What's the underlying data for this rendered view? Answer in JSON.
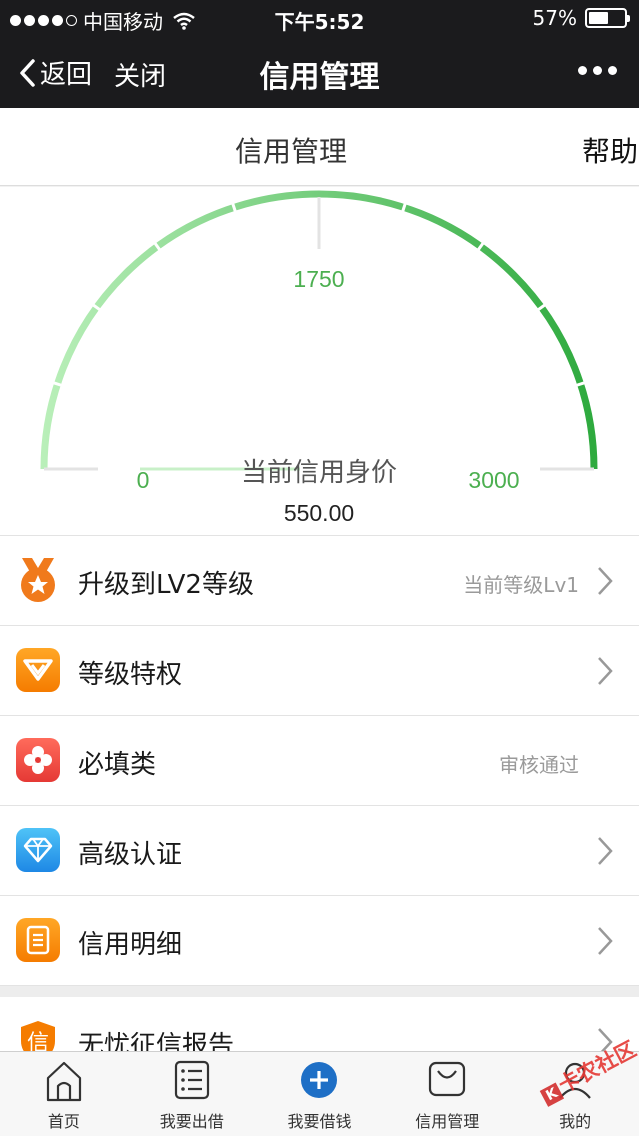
{
  "status_bar": {
    "carrier": "中国移动",
    "time": "下午5:52",
    "battery": "57%",
    "battery_level": 0.57
  },
  "nav": {
    "back_label": "返回",
    "close_label": "关闭",
    "title": "信用管理"
  },
  "subbar": {
    "title": "信用管理",
    "help_label": "帮助"
  },
  "gauge": {
    "min_label": "0",
    "mid_label": "1750",
    "max_label": "3000",
    "caption": "当前信用身价",
    "value": "550.00",
    "colors": {
      "start": "#a5e8a5",
      "end": "#2eaa3e",
      "label": "#4caf50"
    }
  },
  "menu": [
    {
      "label": "升级到LV2等级",
      "value": "当前等级Lv1",
      "icon": "medal-icon",
      "chevron": true,
      "color": "#f07a1c"
    },
    {
      "label": "等级特权",
      "value": "",
      "icon": "v-badge-icon",
      "chevron": true,
      "color": "#f57c00"
    },
    {
      "label": "必填类",
      "value": "审核通过",
      "icon": "clover-icon",
      "chevron": false,
      "color": "#f0443a"
    },
    {
      "label": "高级认证",
      "value": "",
      "icon": "diamond-icon",
      "chevron": true,
      "color": "#2196f3"
    },
    {
      "label": "信用明细",
      "value": "",
      "icon": "document-icon",
      "chevron": true,
      "color": "#f57c00"
    }
  ],
  "report": {
    "label": "无忧征信报告",
    "icon_text": "信",
    "icon": "shield-icon"
  },
  "tabbar": [
    {
      "label": "首页",
      "icon": "home-icon"
    },
    {
      "label": "我要出借",
      "icon": "list-icon"
    },
    {
      "label": "我要借钱",
      "icon": "plus-circle-icon"
    },
    {
      "label": "信用管理",
      "icon": "bag-icon"
    },
    {
      "label": "我的",
      "icon": "user-icon"
    }
  ],
  "watermark": {
    "text": "卡农社区"
  }
}
